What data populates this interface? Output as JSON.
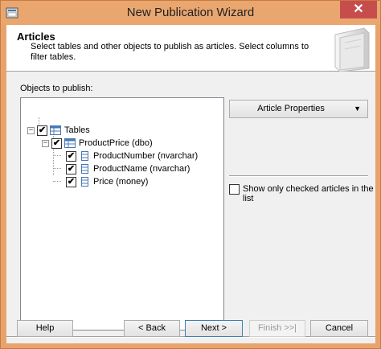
{
  "window": {
    "title": "New Publication Wizard",
    "close_glyph": "✕"
  },
  "header": {
    "title": "Articles",
    "description": "Select tables and other objects to publish as articles. Select columns to filter tables."
  },
  "tree": {
    "label": "Objects to publish:",
    "nodes": [
      {
        "label": "Tables",
        "checked": true,
        "expanded": true,
        "icon": "tables-icon"
      },
      {
        "label": "ProductPrice (dbo)",
        "checked": true,
        "expanded": true,
        "icon": "table-icon"
      },
      {
        "label": "ProductNumber (nvarchar)",
        "checked": true,
        "icon": "column-icon"
      },
      {
        "label": "ProductName (nvarchar)",
        "checked": true,
        "icon": "column-icon"
      },
      {
        "label": "Price (money)",
        "checked": true,
        "icon": "column-icon"
      }
    ]
  },
  "article_properties": {
    "label": "Article Properties",
    "arrow": "▼"
  },
  "show_only": {
    "label": "Show only checked articles in the list",
    "checked": false
  },
  "buttons": {
    "help": "Help",
    "back": "< Back",
    "next": "Next >",
    "finish": "Finish >>|",
    "cancel": "Cancel"
  }
}
